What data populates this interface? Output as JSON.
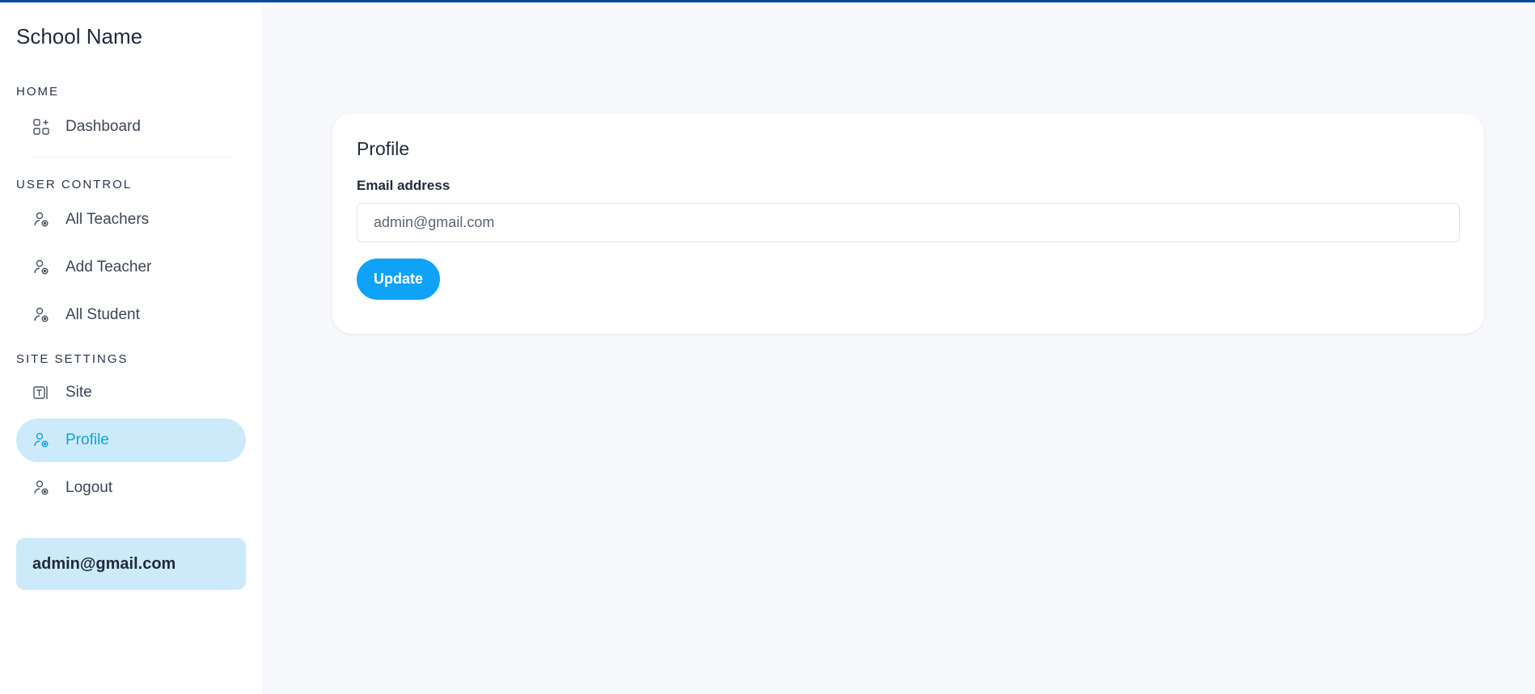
{
  "app": {
    "title": "School Name"
  },
  "sidebar": {
    "sections": [
      {
        "title": "HOME",
        "items": [
          {
            "label": "Dashboard",
            "icon": "dashboard-icon"
          }
        ]
      },
      {
        "title": "USER CONTROL",
        "items": [
          {
            "label": "All Teachers",
            "icon": "user-icon"
          },
          {
            "label": "Add Teacher",
            "icon": "user-icon"
          },
          {
            "label": "All Student",
            "icon": "user-icon"
          }
        ]
      },
      {
        "title": "SITE SETTINGS",
        "items": [
          {
            "label": "Site",
            "icon": "text-icon"
          },
          {
            "label": "Profile",
            "icon": "user-icon",
            "active": true
          },
          {
            "label": "Logout",
            "icon": "user-icon"
          }
        ]
      }
    ],
    "user_email": "admin@gmail.com"
  },
  "profile": {
    "title": "Profile",
    "email_label": "Email address",
    "email_value": "admin@gmail.com",
    "update_label": "Update"
  },
  "colors": {
    "accent": "#0fa3f7",
    "active_bg": "#cdeafb",
    "active_text": "#12a1e0",
    "top_bar": "#0b47a0"
  }
}
